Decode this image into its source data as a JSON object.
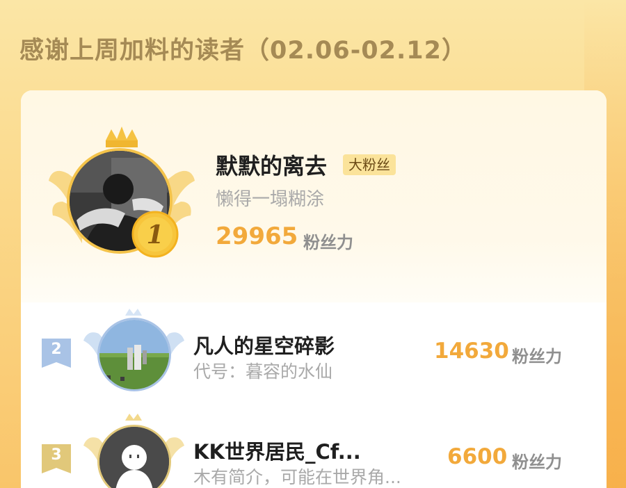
{
  "header": {
    "title": "感谢上周加料的读者（02.06-02.12）"
  },
  "colors": {
    "accent_gold": "#f2a93b",
    "title_brown": "#a58a55",
    "tag_bg": "#fbe39a",
    "silver": "#a9c3e6",
    "bronze": "#e1c87a"
  },
  "leaderboard": {
    "top": {
      "rank": "1",
      "name": "默默的离去",
      "tag": "大粉丝",
      "bio": "懒得一塌糊涂",
      "score": "29965",
      "unit": "粉丝力",
      "avatar_icon": "user-photo-avatar",
      "crown_icon": "crown-icon"
    },
    "rows": [
      {
        "rank": "2",
        "name": "凡人的星空碎影",
        "bio": "代号：暮容的水仙",
        "score": "14630",
        "unit": "粉丝力",
        "avatar_icon": "minecraft-avatar"
      },
      {
        "rank": "3",
        "name": "KK世界居民_Cf...",
        "bio": "木有简介，可能在世界角...",
        "score": "6600",
        "unit": "粉丝力",
        "avatar_icon": "default-avatar"
      }
    ]
  }
}
